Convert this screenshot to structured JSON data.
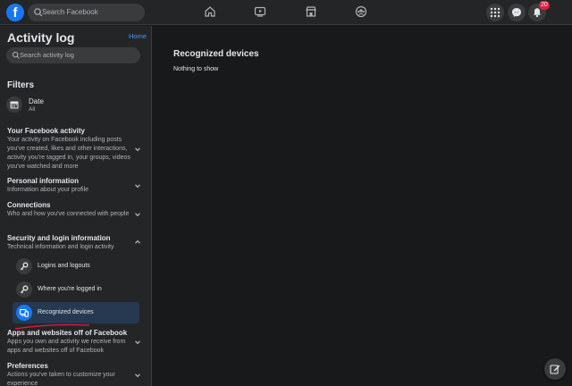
{
  "topbar": {
    "logo_letter": "f",
    "search_placeholder": "Search Facebook",
    "notification_count": "20"
  },
  "sidebar": {
    "title": "Activity log",
    "home_link": "Home",
    "search_placeholder": "Search activity log",
    "filters_heading": "Filters",
    "date_filter": {
      "label": "Date",
      "value": "All"
    },
    "sections": [
      {
        "title": "Your Facebook activity",
        "desc": "Your activity on Facebook including posts you've created, likes and other interactions, activity you're tagged in, your groups, videos you've watched and more"
      },
      {
        "title": "Personal information",
        "desc": "Information about your profile"
      },
      {
        "title": "Connections",
        "desc": "Who and how you've connected with people"
      },
      {
        "title": "Security and login information",
        "desc": "Technical information and login activity"
      },
      {
        "title": "Apps and websites off of Facebook",
        "desc": "Apps you own and activity we receive from apps and websites off of Facebook"
      },
      {
        "title": "Preferences",
        "desc": "Actions you've taken to customize your experience"
      }
    ],
    "security_items": [
      {
        "label": "Logins and logouts",
        "icon": "key-icon"
      },
      {
        "label": "Where you're logged in",
        "icon": "key-icon"
      },
      {
        "label": "Recognized devices",
        "icon": "devices-icon",
        "active": true
      }
    ]
  },
  "main": {
    "title": "Recognized devices",
    "empty_text": "Nothing to show"
  },
  "colors": {
    "accent": "#1877f2",
    "link": "#4599ff",
    "annotation_red": "#e41e3f"
  }
}
